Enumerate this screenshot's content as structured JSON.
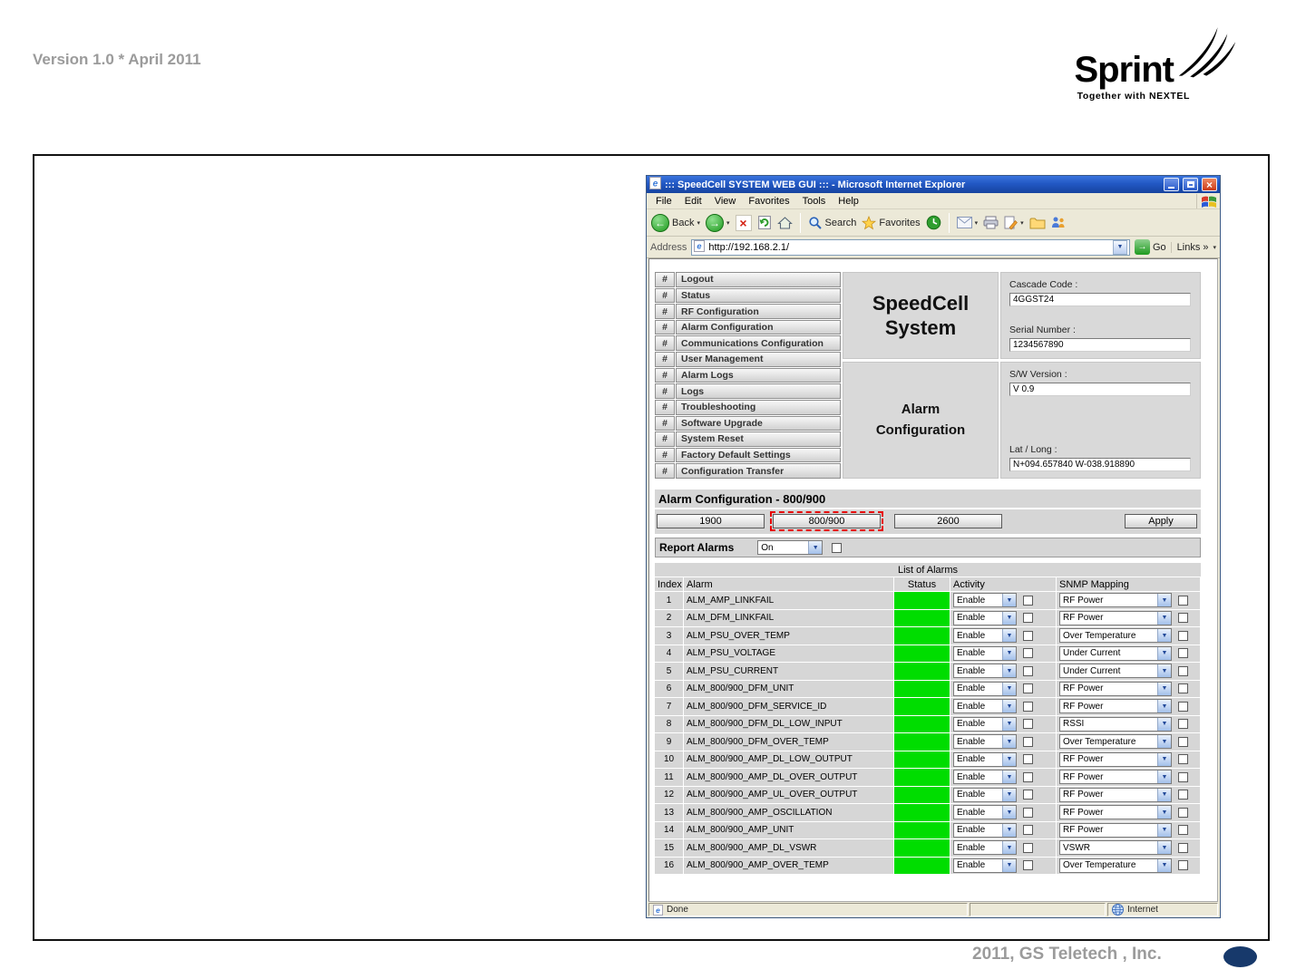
{
  "doc": {
    "version_text": "Version 1.0 * April 2011",
    "footer_text": "2011, GS Teletech , Inc.",
    "logo_brand": "Sprint",
    "logo_tagline": "Together with NEXTEL"
  },
  "icons": {
    "back_arrow": "←",
    "forward_arrow": "→",
    "go_arrow": "→",
    "stop_x": "×",
    "refresh": "↻",
    "caret": "▾",
    "dropdown": "▼",
    "links_chevrons": "»",
    "close_x": "×"
  },
  "browser": {
    "window_title": "::: SpeedCell SYSTEM WEB GUI ::: - Microsoft Internet Explorer",
    "menus": [
      "File",
      "Edit",
      "View",
      "Favorites",
      "Tools",
      "Help"
    ],
    "toolbar": {
      "back": "Back",
      "search": "Search",
      "favorites": "Favorites"
    },
    "address_label": "Address",
    "url": "http://192.168.2.1/",
    "go": "Go",
    "links": "Links",
    "status_done": "Done",
    "status_zone": "Internet"
  },
  "gui": {
    "nav_prefix": "#",
    "nav": [
      "Logout",
      "Status",
      "RF Configuration",
      "Alarm Configuration",
      "Communications Configuration",
      "User Management",
      "Alarm Logs",
      "Logs",
      "Troubleshooting",
      "Software Upgrade",
      "System Reset",
      "Factory Default Settings",
      "Configuration Transfer"
    ],
    "brand_line1": "SpeedCell",
    "brand_line2": "System",
    "title_line1": "Alarm",
    "title_line2": "Configuration",
    "info": [
      {
        "label": "Cascade Code :",
        "value": "4GGST24"
      },
      {
        "label": "Serial Number :",
        "value": "1234567890"
      },
      {
        "label": "S/W Version :",
        "value": "V 0.9"
      },
      {
        "label": "Lat / Long :",
        "value": "N+094.657840 W-038.918890"
      }
    ],
    "section_title": "Alarm Configuration - 800/900",
    "bands": [
      "1900",
      "800/900",
      "2600"
    ],
    "active_band": "800/900",
    "apply": "Apply",
    "report_alarms_label": "Report Alarms",
    "report_alarms_value": "On",
    "alarms": {
      "caption": "List of Alarms",
      "headers": [
        "Index",
        "Alarm",
        "Status",
        "Activity",
        "SNMP Mapping"
      ],
      "rows": [
        {
          "index": "1",
          "alarm": "ALM_AMP_LINKFAIL",
          "status": "green",
          "activity": "Enable",
          "snmp": "RF Power"
        },
        {
          "index": "2",
          "alarm": "ALM_DFM_LINKFAIL",
          "status": "green",
          "activity": "Enable",
          "snmp": "RF Power"
        },
        {
          "index": "3",
          "alarm": "ALM_PSU_OVER_TEMP",
          "status": "green",
          "activity": "Enable",
          "snmp": "Over Temperature"
        },
        {
          "index": "4",
          "alarm": "ALM_PSU_VOLTAGE",
          "status": "green",
          "activity": "Enable",
          "snmp": "Under Current"
        },
        {
          "index": "5",
          "alarm": "ALM_PSU_CURRENT",
          "status": "green",
          "activity": "Enable",
          "snmp": "Under Current"
        },
        {
          "index": "6",
          "alarm": "ALM_800/900_DFM_UNIT",
          "status": "green",
          "activity": "Enable",
          "snmp": "RF Power"
        },
        {
          "index": "7",
          "alarm": "ALM_800/900_DFM_SERVICE_ID",
          "status": "green",
          "activity": "Enable",
          "snmp": "RF Power"
        },
        {
          "index": "8",
          "alarm": "ALM_800/900_DFM_DL_LOW_INPUT",
          "status": "green",
          "activity": "Enable",
          "snmp": "RSSI"
        },
        {
          "index": "9",
          "alarm": "ALM_800/900_DFM_OVER_TEMP",
          "status": "green",
          "activity": "Enable",
          "snmp": "Over Temperature"
        },
        {
          "index": "10",
          "alarm": "ALM_800/900_AMP_DL_LOW_OUTPUT",
          "status": "green",
          "activity": "Enable",
          "snmp": "RF Power"
        },
        {
          "index": "11",
          "alarm": "ALM_800/900_AMP_DL_OVER_OUTPUT",
          "status": "green",
          "activity": "Enable",
          "snmp": "RF Power"
        },
        {
          "index": "12",
          "alarm": "ALM_800/900_AMP_UL_OVER_OUTPUT",
          "status": "green",
          "activity": "Enable",
          "snmp": "RF Power"
        },
        {
          "index": "13",
          "alarm": "ALM_800/900_AMP_OSCILLATION",
          "status": "green",
          "activity": "Enable",
          "snmp": "RF Power"
        },
        {
          "index": "14",
          "alarm": "ALM_800/900_AMP_UNIT",
          "status": "green",
          "activity": "Enable",
          "snmp": "RF Power"
        },
        {
          "index": "15",
          "alarm": "ALM_800/900_AMP_DL_VSWR",
          "status": "green",
          "activity": "Enable",
          "snmp": "VSWR"
        },
        {
          "index": "16",
          "alarm": "ALM_800/900_AMP_OVER_TEMP",
          "status": "green",
          "activity": "Enable",
          "snmp": "Over Temperature"
        }
      ]
    }
  },
  "colors": {
    "status_green": "#00dd00",
    "highlight_red": "#e60000",
    "titlebar_blue": "#2258c4",
    "panel_gray": "#d6d6d6"
  }
}
